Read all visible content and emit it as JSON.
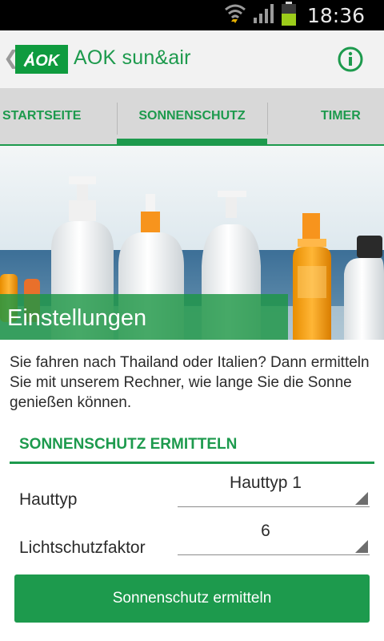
{
  "status_bar": {
    "time": "18:36",
    "icons": [
      "wifi-icon",
      "signal-icon",
      "battery-icon"
    ]
  },
  "action_bar": {
    "logo_text": "AOK",
    "title": "AOK sun&air",
    "back_icon": "chevron-left-icon",
    "info_icon": "info-icon"
  },
  "tabs": [
    {
      "label": "STARTSEITE",
      "selected": false
    },
    {
      "label": "SONNENSCHUTZ",
      "selected": true
    },
    {
      "label": "TIMER",
      "selected": false
    }
  ],
  "hero": {
    "caption": "Einstellungen"
  },
  "content": {
    "intro": "Sie fahren nach Thailand oder Italien? Dann ermitteln Sie mit unserem Rechner, wie lange Sie die Sonne genießen können.",
    "section_title": "SONNENSCHUTZ ERMITTELN",
    "fields": [
      {
        "label": "Hauttyp",
        "value": "Hauttyp 1"
      },
      {
        "label": "Lichtschutzfaktor",
        "value": "6"
      }
    ],
    "button_label": "Sonnenschutz ermitteln"
  },
  "colors": {
    "brand_green": "#1d9a4d",
    "logo_green": "#0f9b3f",
    "tab_background": "#d8d8d8",
    "actionbar_background": "#f2f2f2"
  }
}
